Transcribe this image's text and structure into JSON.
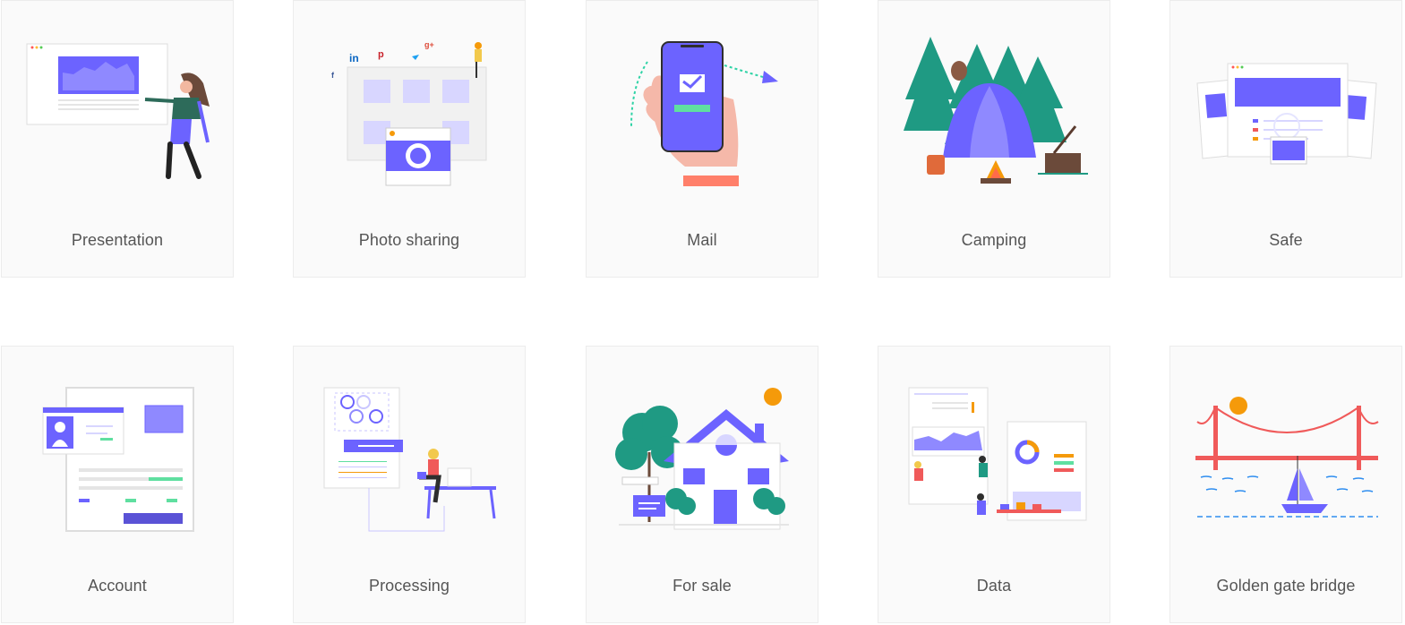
{
  "gallery": {
    "items": [
      {
        "label": "Presentation",
        "icon": "presentation-illustration-icon"
      },
      {
        "label": "Photo sharing",
        "icon": "photo-sharing-illustration-icon"
      },
      {
        "label": "Mail",
        "icon": "mail-illustration-icon"
      },
      {
        "label": "Camping",
        "icon": "camping-illustration-icon"
      },
      {
        "label": "Safe",
        "icon": "safe-illustration-icon"
      },
      {
        "label": "Account",
        "icon": "account-illustration-icon"
      },
      {
        "label": "Processing",
        "icon": "processing-illustration-icon"
      },
      {
        "label": "For sale",
        "icon": "for-sale-illustration-icon"
      },
      {
        "label": "Data",
        "icon": "data-illustration-icon"
      },
      {
        "label": "Golden gate bridge",
        "icon": "golden-gate-bridge-illustration-icon"
      }
    ],
    "social_marks": {
      "linkedin": "in",
      "pinterest": "p",
      "googleplus": "g+",
      "facebook": "f"
    }
  },
  "colors": {
    "accent": "#6c63ff",
    "accent_light": "#d8d6ff",
    "card_bg": "#fafafa",
    "card_border": "#ececec",
    "label": "#555555",
    "tree_green": "#1f9a83",
    "orange": "#f59a0a",
    "bridge_red": "#f05a5a",
    "mint": "#5fdfa0"
  }
}
